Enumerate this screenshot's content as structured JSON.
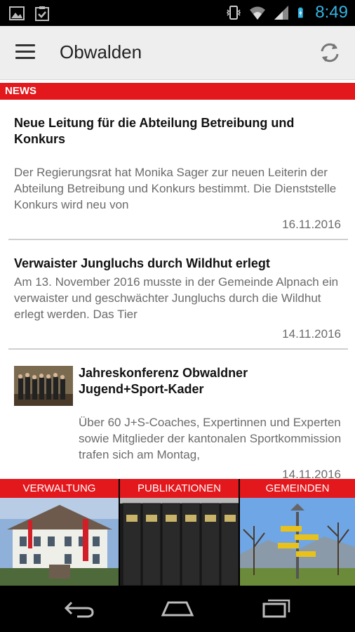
{
  "status_bar": {
    "time": "8:49"
  },
  "app_bar": {
    "title": "Obwalden"
  },
  "section": {
    "label": "NEWS"
  },
  "news": [
    {
      "title": "Neue Leitung für die Abteilung Betreibung und Konkurs",
      "teaser": "Der Regierungsrat hat Monika Sager zur neuen Leiterin der Abteilung Betreibung und Konkurs bestimmt. Die Dienststelle Konkurs wird neu von",
      "date": "16.11.2016"
    },
    {
      "title": "Verwaister Jungluchs durch Wildhut erlegt",
      "teaser": "Am 13. November 2016 musste in der Gemeinde Alpnach ein verwaister und geschwächter Jungluchs durch die Wildhut erlegt werden. Das Tier",
      "date": "14.11.2016"
    },
    {
      "title": "Jahreskonferenz Obwaldner Jugend+Sport-Kader",
      "teaser": "Über 60 J+S-Coaches, Expertinnen und Experten sowie Mitglieder der kantonalen Sportkommission trafen sich am Montag,",
      "date": "14.11.2016"
    }
  ],
  "tiles": [
    {
      "label": "VERWALTUNG"
    },
    {
      "label": "PUBLIKATIONEN"
    },
    {
      "label": "GEMEINDEN"
    }
  ],
  "colors": {
    "accent": "#e3181d",
    "time": "#33b5e5"
  }
}
